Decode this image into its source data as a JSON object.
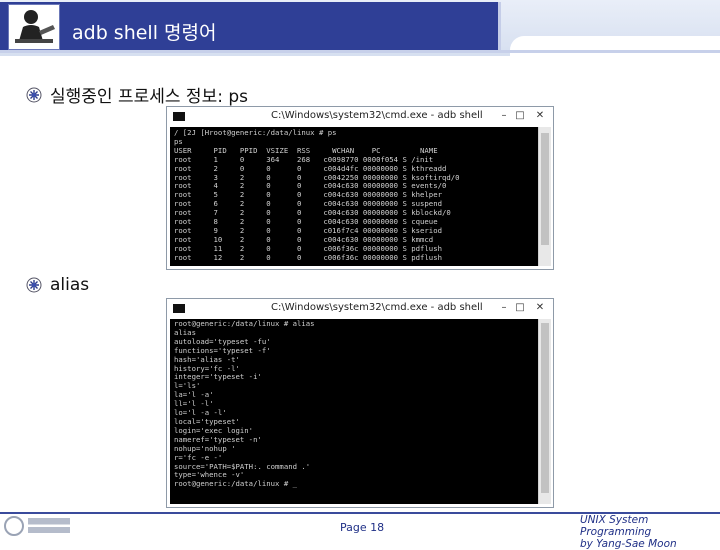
{
  "slide": {
    "title": "adb shell 명령어",
    "bullets": [
      {
        "text": "실행중인 프로세스 정보: ps"
      },
      {
        "text": "alias"
      }
    ],
    "footer": {
      "page": "Page 18",
      "course_line1": "UNIX System Programming",
      "course_line2": "by Yang-Sae Moon"
    }
  },
  "console_ps": {
    "title": "C:\\Windows\\system32\\cmd.exe - adb  shell",
    "buttons": {
      "minimize": "–",
      "maximize": "□",
      "close": "✕"
    },
    "lines": [
      "/ [2J [Hroot@generic:/data/linux # ps",
      "ps",
      "USER     PID   PPID  VSIZE  RSS     WCHAN    PC         NAME",
      "root     1     0     364    268   c0098770 0000f054 S /init",
      "root     2     0     0      0     c004d4fc 00000000 S kthreadd",
      "root     3     2     0      0     c0042250 00000000 S ksoftirqd/0",
      "root     4     2     0      0     c004c630 00000000 S events/0",
      "root     5     2     0      0     c004c630 00000000 S khelper",
      "root     6     2     0      0     c004c630 00000000 S suspend",
      "root     7     2     0      0     c004c630 00000000 S kblockd/0",
      "root     8     2     0      0     c004c630 00000000 S cqueue",
      "root     9     2     0      0     c016f7c4 00000000 S kseriod",
      "root     10    2     0      0     c004c630 00000000 S kmmcd",
      "root     11    2     0      0     c006f36c 00000000 S pdflush",
      "root     12    2     0      0     c006f36c 00000000 S pdflush"
    ]
  },
  "console_alias": {
    "title": "C:\\Windows\\system32\\cmd.exe - adb  shell",
    "buttons": {
      "minimize": "–",
      "maximize": "□",
      "close": "✕"
    },
    "lines": [
      "root@generic:/data/linux # alias",
      "alias",
      "autoload='typeset -fu'",
      "functions='typeset -f'",
      "hash='alias -t'",
      "history='fc -l'",
      "integer='typeset -i'",
      "l='ls'",
      "la='l -a'",
      "ll='l -l'",
      "lo='l -a -l'",
      "local='typeset'",
      "login='exec login'",
      "nameref='typeset -n'",
      "nohup='nohup '",
      "r='fc -e -'",
      "source='PATH=$PATH:. command .'",
      "type='whence -v'",
      "root@generic:/data/linux # _"
    ]
  }
}
